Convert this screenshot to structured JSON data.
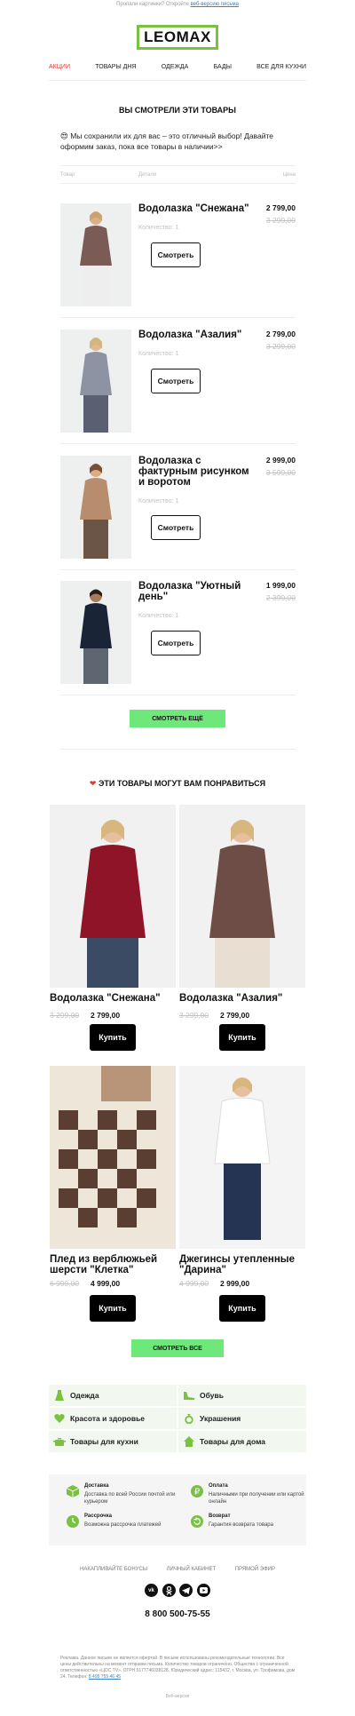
{
  "preheader": {
    "text": "Пропали картинки? Откройте",
    "link": "веб-версию письма"
  },
  "logo": {
    "text": "LEOMAX",
    "color": "#7ac142"
  },
  "nav": [
    {
      "label": "АКЦИИ",
      "active": true
    },
    {
      "label": "ТОВАРЫ ДНЯ",
      "active": false
    },
    {
      "label": "ОДЕЖДА",
      "active": false
    },
    {
      "label": "БАДЫ",
      "active": false
    },
    {
      "label": "ВСЕ ДЛЯ КУХНИ",
      "active": false
    }
  ],
  "viewed": {
    "title": "ВЫ СМОТРЕЛИ ЭТИ ТОВАРЫ",
    "intro": "😍 Мы сохранили их для вас – это отличный выбор! Давайте оформим заказ, пока все товары в наличии>>",
    "headers": {
      "product": "Товар",
      "details": "Детали",
      "price": "Цена"
    },
    "items": [
      {
        "name": "Водолазка \"Снежана\"",
        "price": "2 799,00",
        "old": "3 299,00",
        "qty": "Количество: 1",
        "button": "Смотреть",
        "sweater": "#7a5b55",
        "pants": "#eeeeee"
      },
      {
        "name": "Водолазка \"Азалия\"",
        "price": "2 799,00",
        "old": "3 299,00",
        "qty": "Количество: 1",
        "button": "Смотреть",
        "sweater": "#8e93a3",
        "pants": "#5a6072"
      },
      {
        "name": "Водолазка с фактурным рисунком и воротом",
        "price": "2 999,00",
        "old": "3 599,00",
        "qty": "Количество: 1",
        "button": "Смотреть",
        "sweater": "#b88d6e",
        "pants": "#6b5546"
      },
      {
        "name": "Водолазка \"Уютный день\"",
        "price": "1 999,00",
        "old": "2 399,00",
        "qty": "Количество: 1",
        "button": "Смотреть",
        "sweater": "#1a2437",
        "pants": "#5e6671"
      }
    ],
    "more_button": "СМОТРЕТЬ ЕЩЁ"
  },
  "recommend": {
    "title": "ЭТИ ТОВАРЫ МОГУТ ВАМ ПОНРАВИТЬСЯ",
    "products": [
      {
        "name": "Водолазка \"Снежана\"",
        "old": "3 299,00",
        "price": "2 799,00",
        "button": "Купить",
        "main": "#8f1428",
        "lower": "#3b4b63"
      },
      {
        "name": "Водолазка \"Азалия\"",
        "old": "3 299,00",
        "price": "2 799,00",
        "button": "Купить",
        "main": "#6f4d47",
        "lower": "#e8dfd2"
      },
      {
        "name": "Плед из верблюжьей шерсти \"Клетка\"",
        "old": "6 999,00",
        "price": "4 999,00",
        "button": "Купить",
        "main": "#5a3e31",
        "lower": "#efe6da"
      },
      {
        "name": "Джегинсы утепленные \"Дарина\"",
        "old": "4 999,00",
        "price": "2 999,00",
        "button": "Купить",
        "main": "#f5f5f5",
        "lower": "#253452"
      }
    ],
    "all_button": "СМОТРЕТЬ ВСЕ"
  },
  "categories": [
    {
      "label": "Одежда",
      "icon": "dress-icon"
    },
    {
      "label": "Обувь",
      "icon": "shoe-icon"
    },
    {
      "label": "Красота и здоровье",
      "icon": "heart-icon"
    },
    {
      "label": "Украшения",
      "icon": "ring-icon"
    },
    {
      "label": "Товары для кухни",
      "icon": "pot-icon"
    },
    {
      "label": "Товары для дома",
      "icon": "house-icon"
    }
  ],
  "info": [
    {
      "title": "Доставка",
      "text": "Доставка по всей России почтой или курьером",
      "icon": "box-icon"
    },
    {
      "title": "Оплата",
      "text": "Наличными при получении или картой онлайн",
      "icon": "ruble-icon"
    },
    {
      "title": "Рассрочка",
      "text": "Возможна рассрочка платежей",
      "icon": "clock-icon"
    },
    {
      "title": "Возврат",
      "text": "Гарантия возврата товара",
      "icon": "return-icon"
    }
  ],
  "footer_links": [
    "НАКАПЛИВАЙТЕ БОНУСЫ",
    "ЛИЧНЫЙ КАБИНЕТ",
    "ПРЯМОЙ ЭФИР"
  ],
  "social": [
    "vk-icon",
    "ok-icon",
    "telegram-icon",
    "youtube-icon"
  ],
  "phone": "8 800 500-75-55",
  "legal": {
    "text": "Реклама. Данное письмо не является офертой. В письме использованы рекомендательные технологии. Все цены действительны на момент отправки письма. Количество товаров ограничено. Общество с ограниченной ответственностью «ЦОС TV». ОГРН 5177746038128. Юридический адрес: 115432, г. Москва, ул. Трофимова, дом 24. Телефон:",
    "phone_link": "8 495 755 46 45"
  },
  "footer_mini": "Веб-версия"
}
